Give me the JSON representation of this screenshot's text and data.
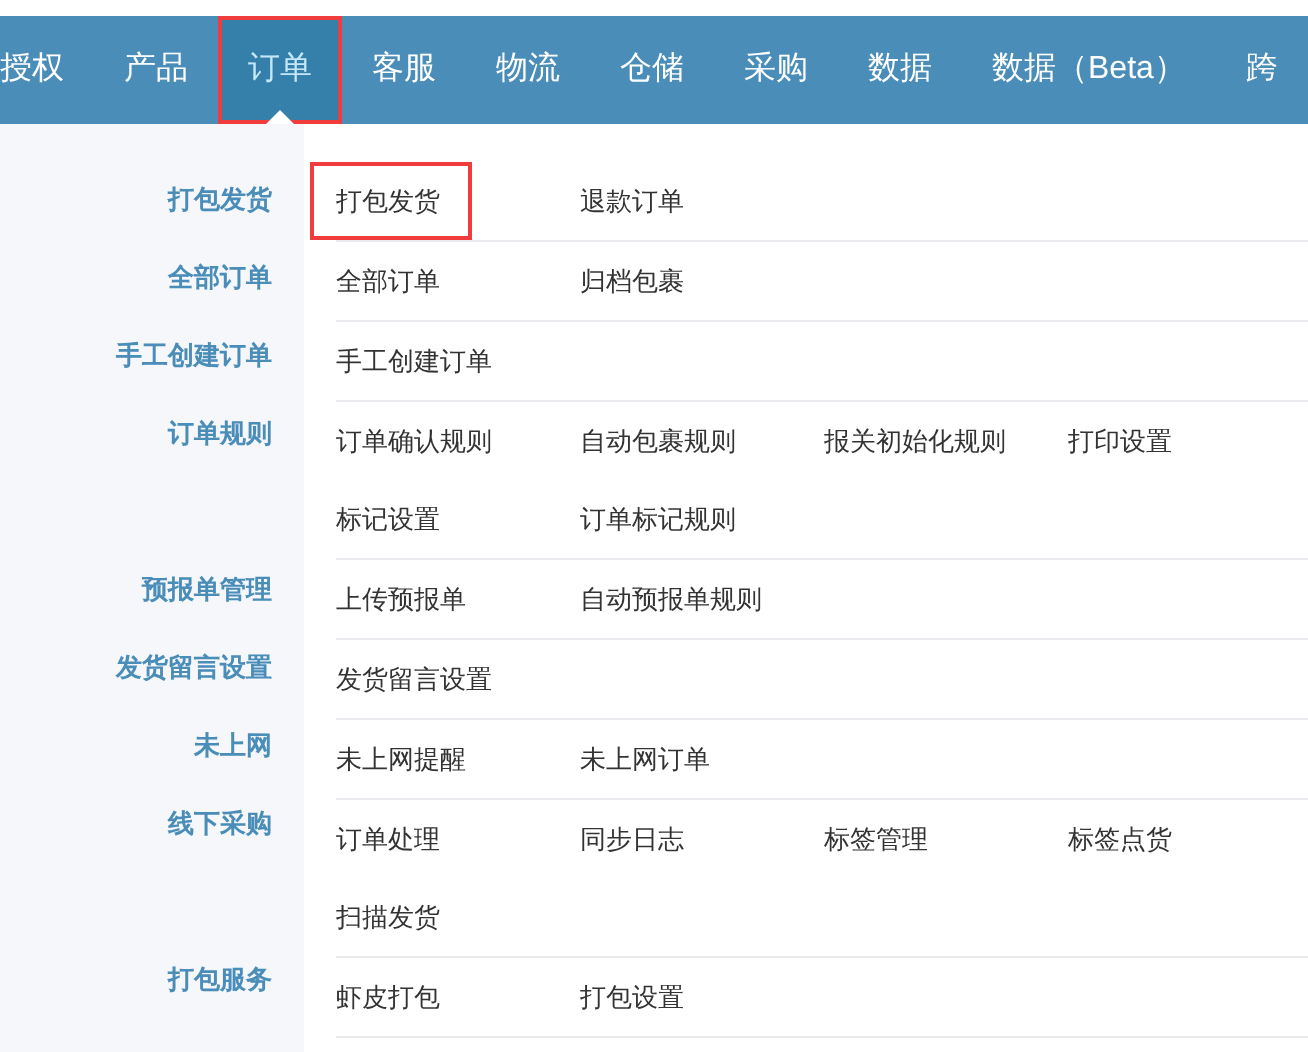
{
  "nav": [
    {
      "label": "授权",
      "selected": false
    },
    {
      "label": "产品",
      "selected": false
    },
    {
      "label": "订单",
      "selected": true
    },
    {
      "label": "客服",
      "selected": false
    },
    {
      "label": "物流",
      "selected": false
    },
    {
      "label": "仓储",
      "selected": false
    },
    {
      "label": "采购",
      "selected": false
    },
    {
      "label": "数据",
      "selected": false
    },
    {
      "label": "数据（Beta）",
      "selected": false
    },
    {
      "label": "跨",
      "selected": false
    }
  ],
  "menu": [
    {
      "label": "打包发货",
      "rows": [
        [
          {
            "label": "打包发货",
            "highlighted": true
          },
          {
            "label": "退款订单",
            "highlighted": false
          }
        ]
      ]
    },
    {
      "label": "全部订单",
      "rows": [
        [
          {
            "label": "全部订单",
            "highlighted": false
          },
          {
            "label": "归档包裹",
            "highlighted": false
          }
        ]
      ]
    },
    {
      "label": "手工创建订单",
      "rows": [
        [
          {
            "label": "手工创建订单",
            "highlighted": false
          }
        ]
      ]
    },
    {
      "label": "订单规则",
      "rows": [
        [
          {
            "label": "订单确认规则",
            "highlighted": false
          },
          {
            "label": "自动包裹规则",
            "highlighted": false
          },
          {
            "label": "报关初始化规则",
            "highlighted": false
          },
          {
            "label": "打印设置",
            "highlighted": false
          }
        ],
        [
          {
            "label": "标记设置",
            "highlighted": false
          },
          {
            "label": "订单标记规则",
            "highlighted": false
          }
        ]
      ]
    },
    {
      "label": "预报单管理",
      "rows": [
        [
          {
            "label": "上传预报单",
            "highlighted": false
          },
          {
            "label": "自动预报单规则",
            "highlighted": false
          }
        ]
      ]
    },
    {
      "label": "发货留言设置",
      "rows": [
        [
          {
            "label": "发货留言设置",
            "highlighted": false
          }
        ]
      ]
    },
    {
      "label": "未上网",
      "rows": [
        [
          {
            "label": "未上网提醒",
            "highlighted": false
          },
          {
            "label": "未上网订单",
            "highlighted": false
          }
        ]
      ]
    },
    {
      "label": "线下采购",
      "rows": [
        [
          {
            "label": "订单处理",
            "highlighted": false
          },
          {
            "label": "同步日志",
            "highlighted": false
          },
          {
            "label": "标签管理",
            "highlighted": false
          },
          {
            "label": "标签点货",
            "highlighted": false
          }
        ],
        [
          {
            "label": "扫描发货",
            "highlighted": false
          }
        ]
      ]
    },
    {
      "label": "打包服务",
      "rows": [
        [
          {
            "label": "虾皮打包",
            "highlighted": false
          },
          {
            "label": "打包设置",
            "highlighted": false
          }
        ]
      ]
    }
  ]
}
